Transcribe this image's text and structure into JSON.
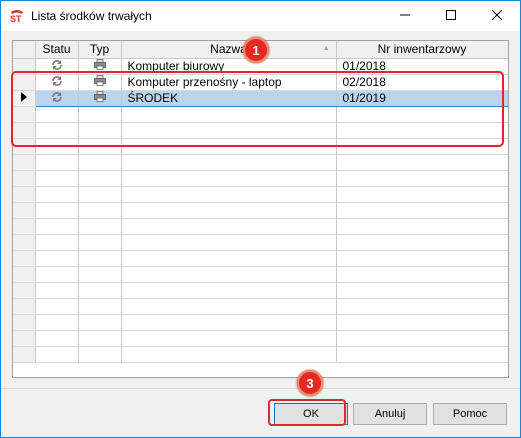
{
  "window": {
    "title": "Lista środków trwałych",
    "app_icon": "app-logo-icon",
    "controls": [
      "minimize-icon",
      "maximize-icon",
      "close-icon"
    ]
  },
  "table": {
    "columns": [
      "",
      "Statu",
      "Typ",
      "Nazwa",
      "Nr inwentarzowy"
    ],
    "rows": [
      {
        "status_icon": "refresh-icon",
        "type_icon": "printer-icon",
        "name": "Komputer biurowy",
        "inv": "01/2018",
        "selected": false
      },
      {
        "status_icon": "refresh-icon",
        "type_icon": "printer-icon",
        "name": "Komputer przenośny - laptop",
        "inv": "02/2018",
        "selected": false
      },
      {
        "status_icon": "refresh-icon",
        "type_icon": "printer-icon",
        "name": "ŚRODEK",
        "inv": "01/2019",
        "selected": true
      }
    ],
    "empty_row_count": 16,
    "current_row_marker": "current-row-arrow-icon"
  },
  "annotations": {
    "badge_1": "1",
    "badge_3": "3",
    "highlight_color": "#e0272b"
  },
  "buttons": {
    "ok": "OK",
    "cancel": "Anuluj",
    "help": "Pomoc"
  },
  "colors": {
    "selection": "#b9d4ec",
    "accent": "#0078d7",
    "window_border": "#1883d7"
  }
}
